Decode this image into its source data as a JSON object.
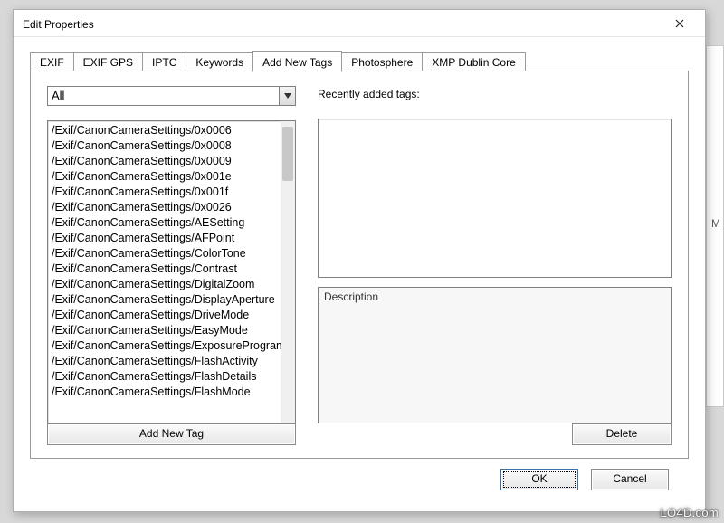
{
  "window": {
    "title": "Edit Properties"
  },
  "tabs": [
    {
      "label": "EXIF"
    },
    {
      "label": "EXIF GPS"
    },
    {
      "label": "IPTC"
    },
    {
      "label": "Keywords"
    },
    {
      "label": "Add New Tags"
    },
    {
      "label": "Photosphere"
    },
    {
      "label": "XMP Dublin Core"
    }
  ],
  "activeTabIndex": 4,
  "addNewTags": {
    "filter": {
      "selected": "All"
    },
    "recentLabel": "Recently added tags:",
    "descriptionLabel": "Description",
    "addButton": "Add New Tag",
    "deleteButton": "Delete",
    "list": [
      "/Exif/CanonCameraSettings/0x0006",
      "/Exif/CanonCameraSettings/0x0008",
      "/Exif/CanonCameraSettings/0x0009",
      "/Exif/CanonCameraSettings/0x001e",
      "/Exif/CanonCameraSettings/0x001f",
      "/Exif/CanonCameraSettings/0x0026",
      "/Exif/CanonCameraSettings/AESetting",
      "/Exif/CanonCameraSettings/AFPoint",
      "/Exif/CanonCameraSettings/ColorTone",
      "/Exif/CanonCameraSettings/Contrast",
      "/Exif/CanonCameraSettings/DigitalZoom",
      "/Exif/CanonCameraSettings/DisplayAperture",
      "/Exif/CanonCameraSettings/DriveMode",
      "/Exif/CanonCameraSettings/EasyMode",
      "/Exif/CanonCameraSettings/ExposureProgram",
      "/Exif/CanonCameraSettings/FlashActivity",
      "/Exif/CanonCameraSettings/FlashDetails",
      "/Exif/CanonCameraSettings/FlashMode"
    ]
  },
  "buttons": {
    "ok": "OK",
    "cancel": "Cancel"
  },
  "backdrop": {
    "letter": "M"
  },
  "watermark": "LO4D.com"
}
